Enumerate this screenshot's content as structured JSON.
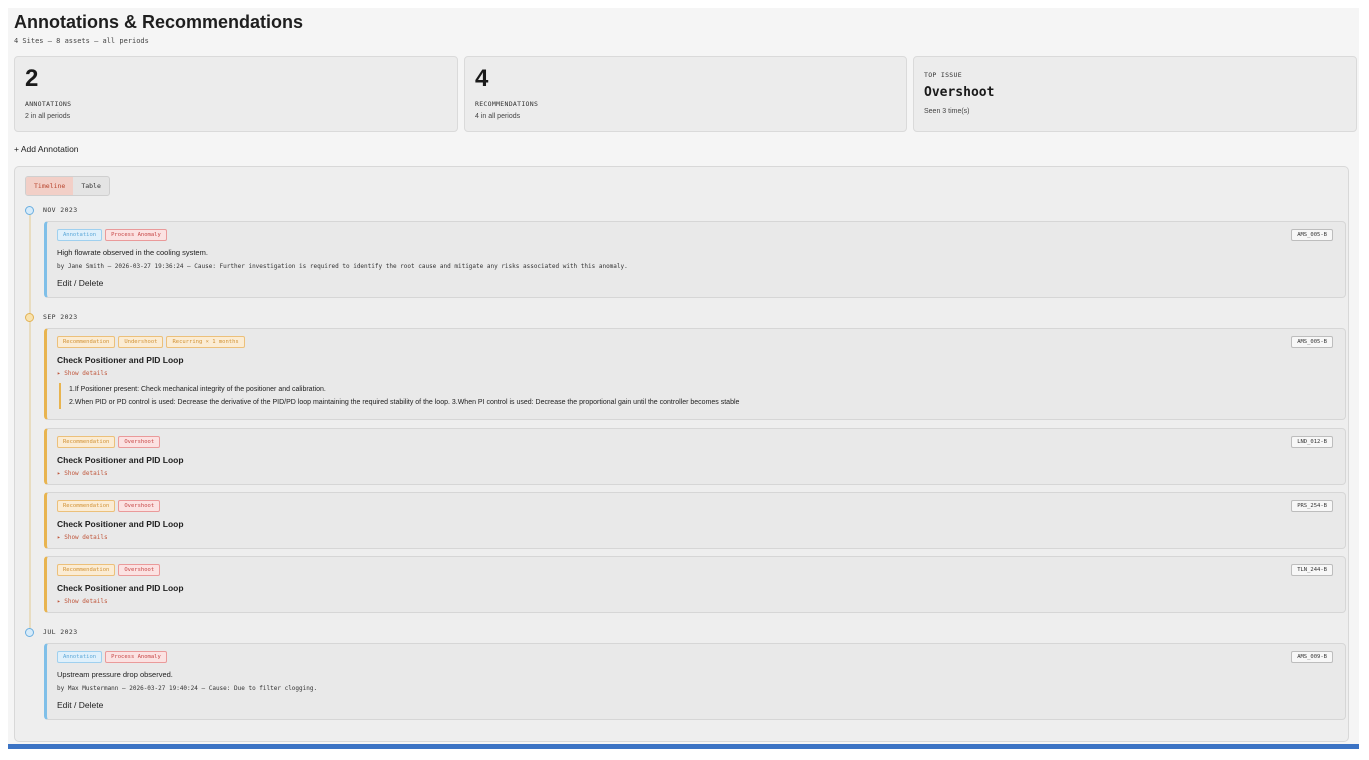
{
  "header": {
    "title": "Annotations & Recommendations",
    "subtitle": "4 Sites — 8 assets — all periods"
  },
  "stats": {
    "annotations": {
      "value": "2",
      "label": "ANNOTATIONS",
      "sub": "2 in all periods"
    },
    "recommendations": {
      "value": "4",
      "label": "RECOMMENDATIONS",
      "sub": "4 in all periods"
    },
    "top_issue": {
      "label": "TOP ISSUE",
      "value": "Overshoot",
      "sub": "Seen 3 time(s)"
    }
  },
  "actions": {
    "add_annotation": "+ Add Annotation"
  },
  "view_tabs": {
    "timeline": "Timeline",
    "table": "Table",
    "active": "Timeline"
  },
  "timeline": [
    {
      "month": "NOV 2023",
      "items": [
        {
          "kind": "annotation",
          "badges": [
            "Annotation",
            "Process Anomaly"
          ],
          "asset": "AMS_005-B",
          "text": "High flowrate observed in the cooling system.",
          "meta": "by Jane Smith — 2026-03-27 19:36:24 — Cause: Further investigation is required to identify the root cause and mitigate any risks associated with this anomaly.",
          "actions": "Edit / Delete"
        }
      ]
    },
    {
      "month": "SEP 2023",
      "items": [
        {
          "kind": "recommendation",
          "badges": [
            "Recommendation",
            "Undershoot",
            "Recurring × 1 months"
          ],
          "asset": "AMS_005-B",
          "title": "Check Positioner and PID Loop",
          "toggle": "▸ Show details",
          "details": [
            "1.If Positioner present: Check mechanical integrity of the positioner and calibration.",
            "2.When PID or PD control is used: Decrease the derivative of the PID/PD loop maintaining the required stability of the loop. 3.When PI control is used: Decrease the proportional gain until the controller becomes stable"
          ]
        },
        {
          "kind": "recommendation",
          "badges": [
            "Recommendation",
            "Overshoot"
          ],
          "asset": "LND_012-B",
          "title": "Check Positioner and PID Loop",
          "toggle": "▸ Show details"
        },
        {
          "kind": "recommendation",
          "badges": [
            "Recommendation",
            "Overshoot"
          ],
          "asset": "PRS_254-B",
          "title": "Check Positioner and PID Loop",
          "toggle": "▸ Show details"
        },
        {
          "kind": "recommendation",
          "badges": [
            "Recommendation",
            "Overshoot"
          ],
          "asset": "TLN_244-B",
          "title": "Check Positioner and PID Loop",
          "toggle": "▸ Show details"
        }
      ]
    },
    {
      "month": "JUL 2023",
      "items": [
        {
          "kind": "annotation",
          "badges": [
            "Annotation",
            "Process Anomaly"
          ],
          "asset": "AMS_009-B",
          "text": "Upstream pressure drop observed.",
          "meta": "by Max Mustermann — 2026-03-27 19:40:24 — Cause: Due to filter clogging.",
          "actions": "Edit / Delete"
        }
      ]
    }
  ],
  "colors": {
    "accent_blue": "#3b73c4",
    "annotation": "#7fbfe8",
    "recommendation": "#e8b450",
    "anomaly": "#c64545"
  },
  "icons": {
    "timeline_node_annotation": "circle-node-icon",
    "timeline_node_recommendation": "circle-node-icon",
    "details_toggle": "triangle-right-icon"
  }
}
